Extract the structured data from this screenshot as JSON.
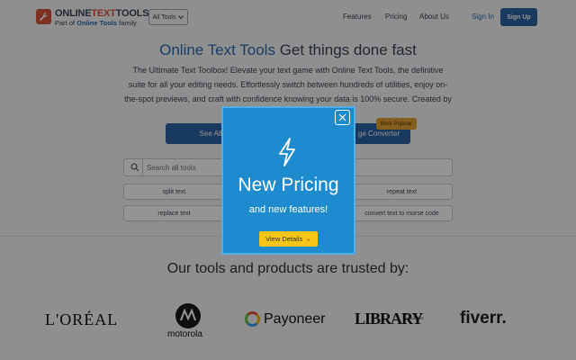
{
  "header": {
    "logo_prefix": "ONLINE",
    "logo_highlight": "TEXT",
    "logo_suffix": "TOOLS",
    "logo_sub_prefix": "Part of ",
    "logo_sub_highlight": "Online Tools",
    "logo_sub_suffix": " family",
    "all_tools_label": "All Tools",
    "nav": [
      "Features",
      "Pricing",
      "About Us"
    ],
    "sign_in": "Sign In",
    "sign_up": "Sign Up"
  },
  "hero": {
    "title_highlight": "Online Text Tools",
    "title_rest": " Get things done fast",
    "description": "The Ultimate Text Toolbox! Elevate your text game with Online Text Tools, the definitive suite for all your editing needs. Effortlessly switch between hundreds of utilities, enjoy on-the-spot previews, and craft with confidence knowing your data is 100% secure. Created by team Browserling.",
    "see_all_label": "See All",
    "converter_label": "ge Converter",
    "badge_label": "Most Popular"
  },
  "search": {
    "placeholder": "Search all tools"
  },
  "chips": [
    "split text",
    "repeat text",
    "replace text",
    "convert text to morse code"
  ],
  "trusted": {
    "title": "Our tools and products are trusted by:",
    "brands": [
      "L'ORÉAL",
      "motorola",
      "Payoneer",
      "LIBRARY",
      "OF CONGRESS",
      "fiverr."
    ]
  },
  "modal": {
    "title": "New Pricing",
    "subtitle": "and new features!",
    "button_label": "View Details →"
  },
  "colors": {
    "brand_blue": "#2e63a4",
    "modal_blue": "#1f8bcf",
    "accent_yellow": "#f5c518",
    "logo_red": "#d8533c"
  }
}
